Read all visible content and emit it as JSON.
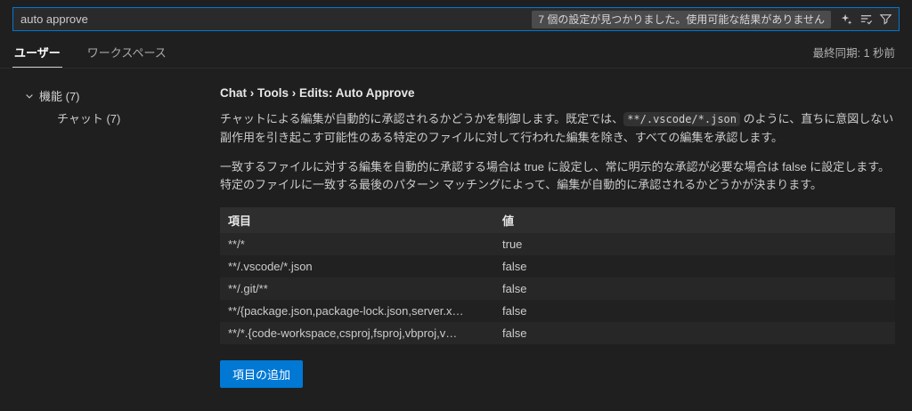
{
  "colors": {
    "accent": "#0078d4",
    "focus_border": "#0078d4"
  },
  "search": {
    "value": "auto approve",
    "results_badge": "7 個の設定が見つかりました。使用可能な結果がありません",
    "icons": [
      "ai-search-icon",
      "filter-list-icon",
      "filter-icon"
    ]
  },
  "tabs": [
    {
      "label": "ユーザー",
      "active": true
    },
    {
      "label": "ワークスペース",
      "active": false
    }
  ],
  "sync_status": "最終同期: 1 秒前",
  "toc": [
    {
      "label": "機能 (7)",
      "level": 0,
      "expanded": true
    },
    {
      "label": "チャット (7)",
      "level": 1
    }
  ],
  "setting": {
    "title": "Chat › Tools › Edits: Auto Approve",
    "desc1_before": "チャットによる編集が自動的に承認されるかどうかを制御します。既定では、",
    "desc1_code": "**/.vscode/*.json",
    "desc1_after": " のように、直ちに意図しない副作用を引き起こす可能性のある特定のファイルに対して行われた編集を除き、すべての編集を承認します。",
    "desc2": "一致するファイルに対する編集を自動的に承認する場合は true に設定し、常に明示的な承認が必要な場合は false に設定します。特定のファイルに一致する最後のパターン マッチングによって、編集が自動的に承認されるかどうかが決まります。",
    "table": {
      "headers": [
        "項目",
        "値"
      ],
      "rows": [
        {
          "key": "**/*",
          "value": "true"
        },
        {
          "key": "**/.vscode/*.json",
          "value": "false"
        },
        {
          "key": "**/.git/**",
          "value": "false"
        },
        {
          "key": "**/{package.json,package-lock.json,server.x…",
          "value": "false"
        },
        {
          "key": "**/*.{code-workspace,csproj,fsproj,vbproj,v…",
          "value": "false"
        }
      ]
    },
    "add_button": "項目の追加"
  }
}
